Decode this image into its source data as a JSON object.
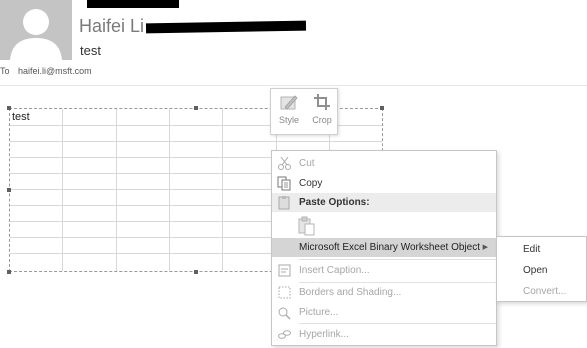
{
  "header": {
    "sender_name": "Haifei Li",
    "subject": "test",
    "to_label": "To",
    "to_address": "haifei.li@msft.com"
  },
  "document": {
    "cell_text": "test"
  },
  "mini_toolbar": {
    "style_label": "Style",
    "crop_label": "Crop"
  },
  "context_menu": {
    "cut": "Cut",
    "copy": "Copy",
    "paste_options": "Paste Options:",
    "object_item": "Microsoft Excel Binary Worksheet Object",
    "insert_caption": "Insert Caption...",
    "borders_shading": "Borders and Shading...",
    "picture": "Picture...",
    "hyperlink": "Hyperlink..."
  },
  "submenu": {
    "edit": "Edit",
    "open": "Open",
    "convert": "Convert..."
  }
}
